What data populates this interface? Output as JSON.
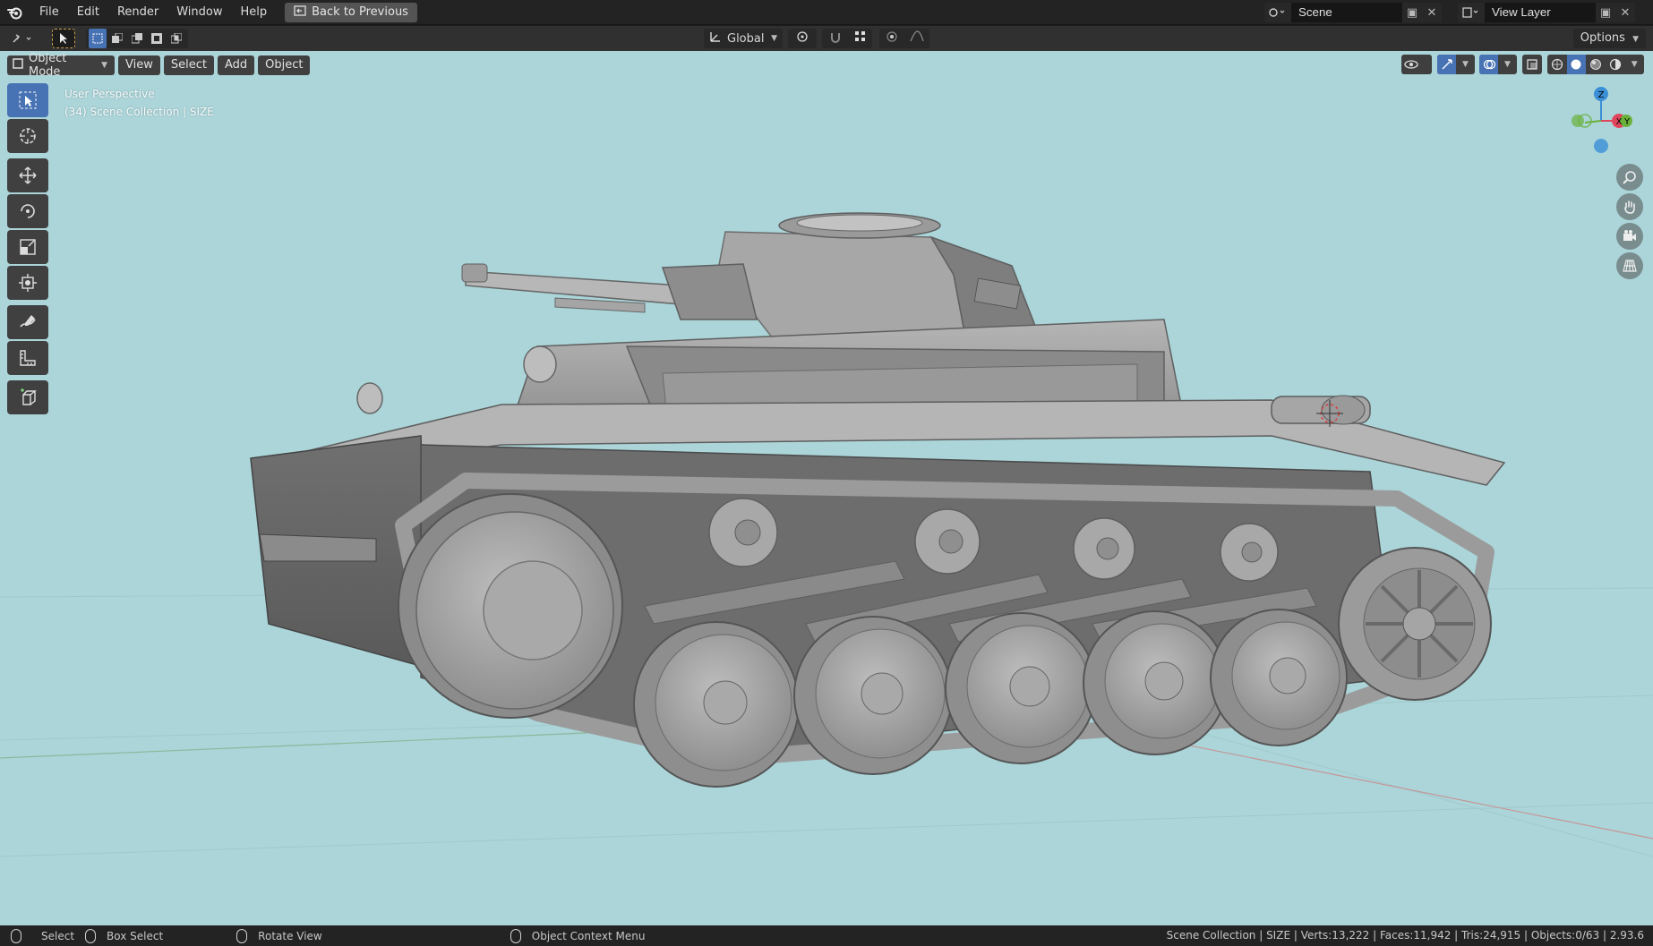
{
  "menu": {
    "items": [
      "File",
      "Edit",
      "Render",
      "Window",
      "Help"
    ],
    "back_button": "Back to Previous"
  },
  "scene": {
    "name": "Scene",
    "view_layer": "View Layer"
  },
  "header": {
    "transform_orientation": "Global",
    "options": "Options"
  },
  "viewport": {
    "mode": "Object Mode",
    "menus": [
      "View",
      "Select",
      "Add",
      "Object"
    ],
    "perspective": "User Perspective",
    "collection_info": "(34) Scene Collection | SIZE",
    "background_color": "#abd5d9"
  },
  "gizmo": {
    "z": "Z",
    "x": "X",
    "y": "Y"
  },
  "statusbar": {
    "select": "Select",
    "box_select": "Box Select",
    "rotate_view": "Rotate View",
    "context_menu": "Object Context Menu",
    "stats": "Scene Collection | SIZE | Verts:13,222 | Faces:11,942 | Tris:24,915 | Objects:0/63 | 2.93.6"
  },
  "colors": {
    "accent": "#4772b3",
    "axis_x": "#e0455e",
    "axis_y": "#6ab13b",
    "axis_z": "#3b8fd6"
  }
}
